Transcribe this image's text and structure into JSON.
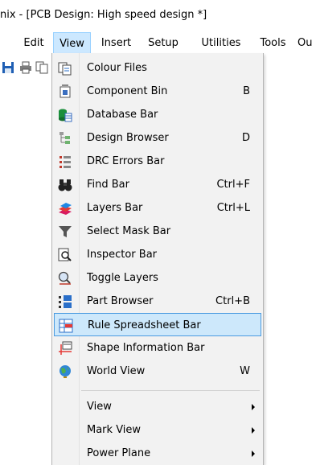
{
  "window": {
    "title": "nix - [PCB Design: High speed design *]"
  },
  "menubar": {
    "items": [
      {
        "label": "Edit"
      },
      {
        "label": "View"
      },
      {
        "label": "Insert"
      },
      {
        "label": "Setup"
      },
      {
        "label": "Utilities"
      },
      {
        "label": "Tools"
      },
      {
        "label": "Ou"
      }
    ],
    "active": "View"
  },
  "toolbar": {
    "icons": [
      "save-icon",
      "print-icon",
      "copy-icon"
    ]
  },
  "view_menu": {
    "items": [
      {
        "label": "Colour Files",
        "shortcut": "",
        "icon": "colour-files-icon"
      },
      {
        "label": "Component Bin",
        "shortcut": "B",
        "icon": "component-bin-icon"
      },
      {
        "label": "Database Bar",
        "shortcut": "",
        "icon": "database-icon"
      },
      {
        "label": "Design Browser",
        "shortcut": "D",
        "icon": "design-browser-icon"
      },
      {
        "label": "DRC Errors Bar",
        "shortcut": "",
        "icon": "drc-errors-icon"
      },
      {
        "label": "Find Bar",
        "shortcut": "Ctrl+F",
        "icon": "binoculars-icon"
      },
      {
        "label": "Layers Bar",
        "shortcut": "Ctrl+L",
        "icon": "layers-icon"
      },
      {
        "label": "Select Mask Bar",
        "shortcut": "",
        "icon": "filter-icon"
      },
      {
        "label": "Inspector Bar",
        "shortcut": "",
        "icon": "inspector-icon"
      },
      {
        "label": "Toggle Layers",
        "shortcut": "",
        "icon": "toggle-layers-icon"
      },
      {
        "label": "Part Browser",
        "shortcut": "Ctrl+B",
        "icon": "part-browser-icon"
      },
      {
        "label": "Rule Spreadsheet Bar",
        "shortcut": "",
        "icon": "rule-spreadsheet-icon"
      },
      {
        "label": "Shape Information Bar",
        "shortcut": "",
        "icon": "shape-info-icon"
      },
      {
        "label": "World View",
        "shortcut": "W",
        "icon": "globe-icon"
      }
    ],
    "highlighted": "Rule Spreadsheet Bar",
    "submenus": [
      {
        "label": "View"
      },
      {
        "label": "Mark View"
      },
      {
        "label": "Power Plane"
      }
    ]
  },
  "colors": {
    "menu_bg": "#f2f2f2",
    "highlight_bg": "#cde8fb",
    "highlight_border": "#4a9be0",
    "menubar_active_bg": "#cce8ff"
  }
}
